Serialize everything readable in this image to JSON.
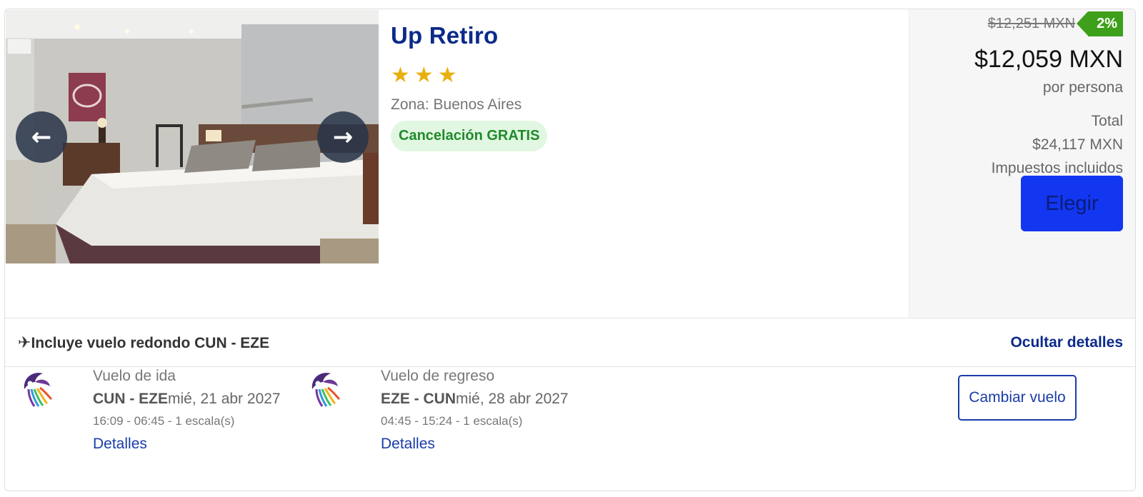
{
  "hotel": {
    "name": "Up Retiro",
    "star_count": 3,
    "zone": "Zona: Buenos Aires",
    "free_cancellation": "Cancelación GRATIS",
    "photo_prev_icon": "arrow-left-icon",
    "photo_next_icon": "arrow-right-icon"
  },
  "pricing": {
    "old_price": "$12,251 MXN",
    "discount": "2%",
    "price": "$12,059 MXN",
    "per_person": "por persona",
    "total_label": "Total",
    "total_value": "$24,117 MXN",
    "taxes": "Impuestos incluidos",
    "choose_button": "Elegir"
  },
  "flight_summary": {
    "title": "Incluye vuelo redondo CUN - EZE",
    "icon": "airplane-icon",
    "hide_details": "Ocultar detalles"
  },
  "flights": [
    {
      "title": "Vuelo de ida",
      "route": "CUN - EZE",
      "date": "mié, 21 abr 2027",
      "times": "16:09 - 06:45 - 1 escala(s)",
      "details": "Detalles"
    },
    {
      "title": "Vuelo de regreso",
      "route": "EZE - CUN",
      "date": "mié, 28 abr 2027",
      "times": "04:45 - 15:24 - 1 escala(s)",
      "details": "Detalles"
    }
  ],
  "change_flight_button": "Cambiar vuelo",
  "colors": {
    "brand_blue": "#0b2a8a",
    "button_blue": "#1336f0",
    "link_blue": "#1a3ca8",
    "discount_green": "#3ea01a",
    "star_gold": "#e8b00f",
    "cancel_green": "#1f8a2c"
  }
}
